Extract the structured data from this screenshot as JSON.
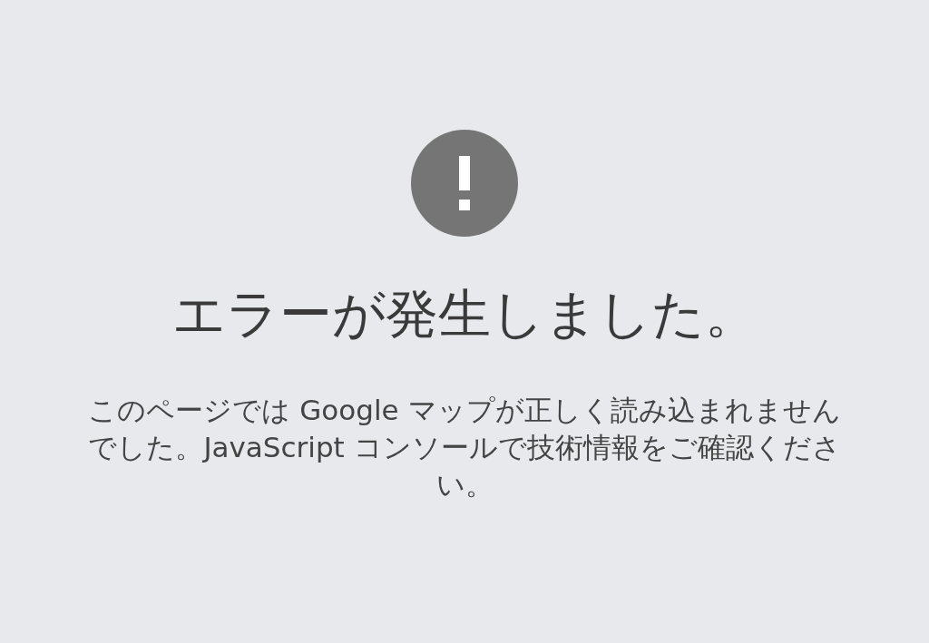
{
  "error": {
    "title": "エラーが発生しました。",
    "message": "このページでは Google マップが正しく読み込まれませんでした。JavaScript コンソールで技術情報をご確認ください。"
  }
}
